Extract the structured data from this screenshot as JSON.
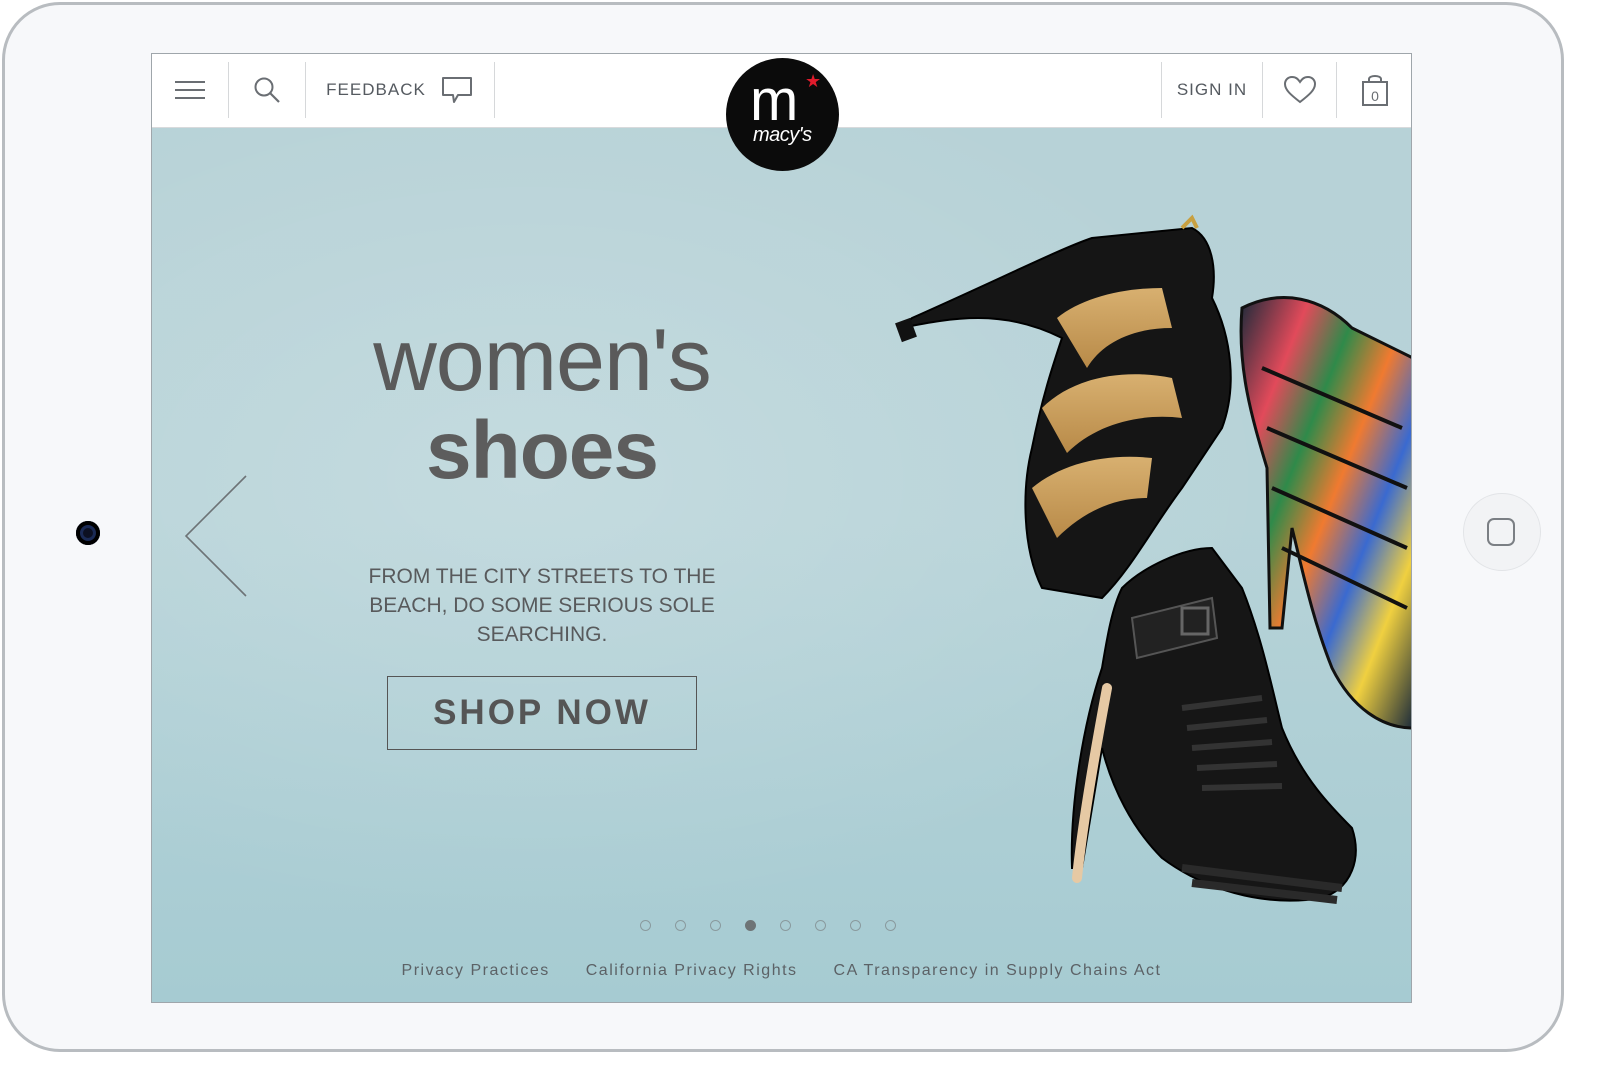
{
  "header": {
    "feedback_label": "FEEDBACK",
    "signin_label": "SIGN IN",
    "bag_count": "0",
    "logo_letter": "m",
    "logo_word": "macy's",
    "logo_star": "★"
  },
  "hero": {
    "headline_line1": "women's",
    "headline_line2": "shoes",
    "subtext": "FROM THE CITY STREETS TO THE BEACH, DO SOME SERIOUS SOLE SEARCHING.",
    "cta_label": "SHOP NOW"
  },
  "carousel": {
    "total_slides": 8,
    "active_slide": 4
  },
  "footer": {
    "links": [
      "Privacy Practices",
      "California Privacy Rights",
      "CA Transparency in Supply Chains Act"
    ]
  },
  "icons": {
    "menu": "menu-icon",
    "search": "search-icon",
    "feedback": "speech-bubble-icon",
    "wishlist": "heart-icon",
    "bag": "shopping-bag-icon",
    "prev": "chevron-left-icon",
    "home": "home-button-icon"
  },
  "colors": {
    "hero_bg": "#b5d4d8",
    "text_dark": "#5a5a5a",
    "logo_bg": "#0b0b0b",
    "logo_star": "#e01b2c"
  }
}
